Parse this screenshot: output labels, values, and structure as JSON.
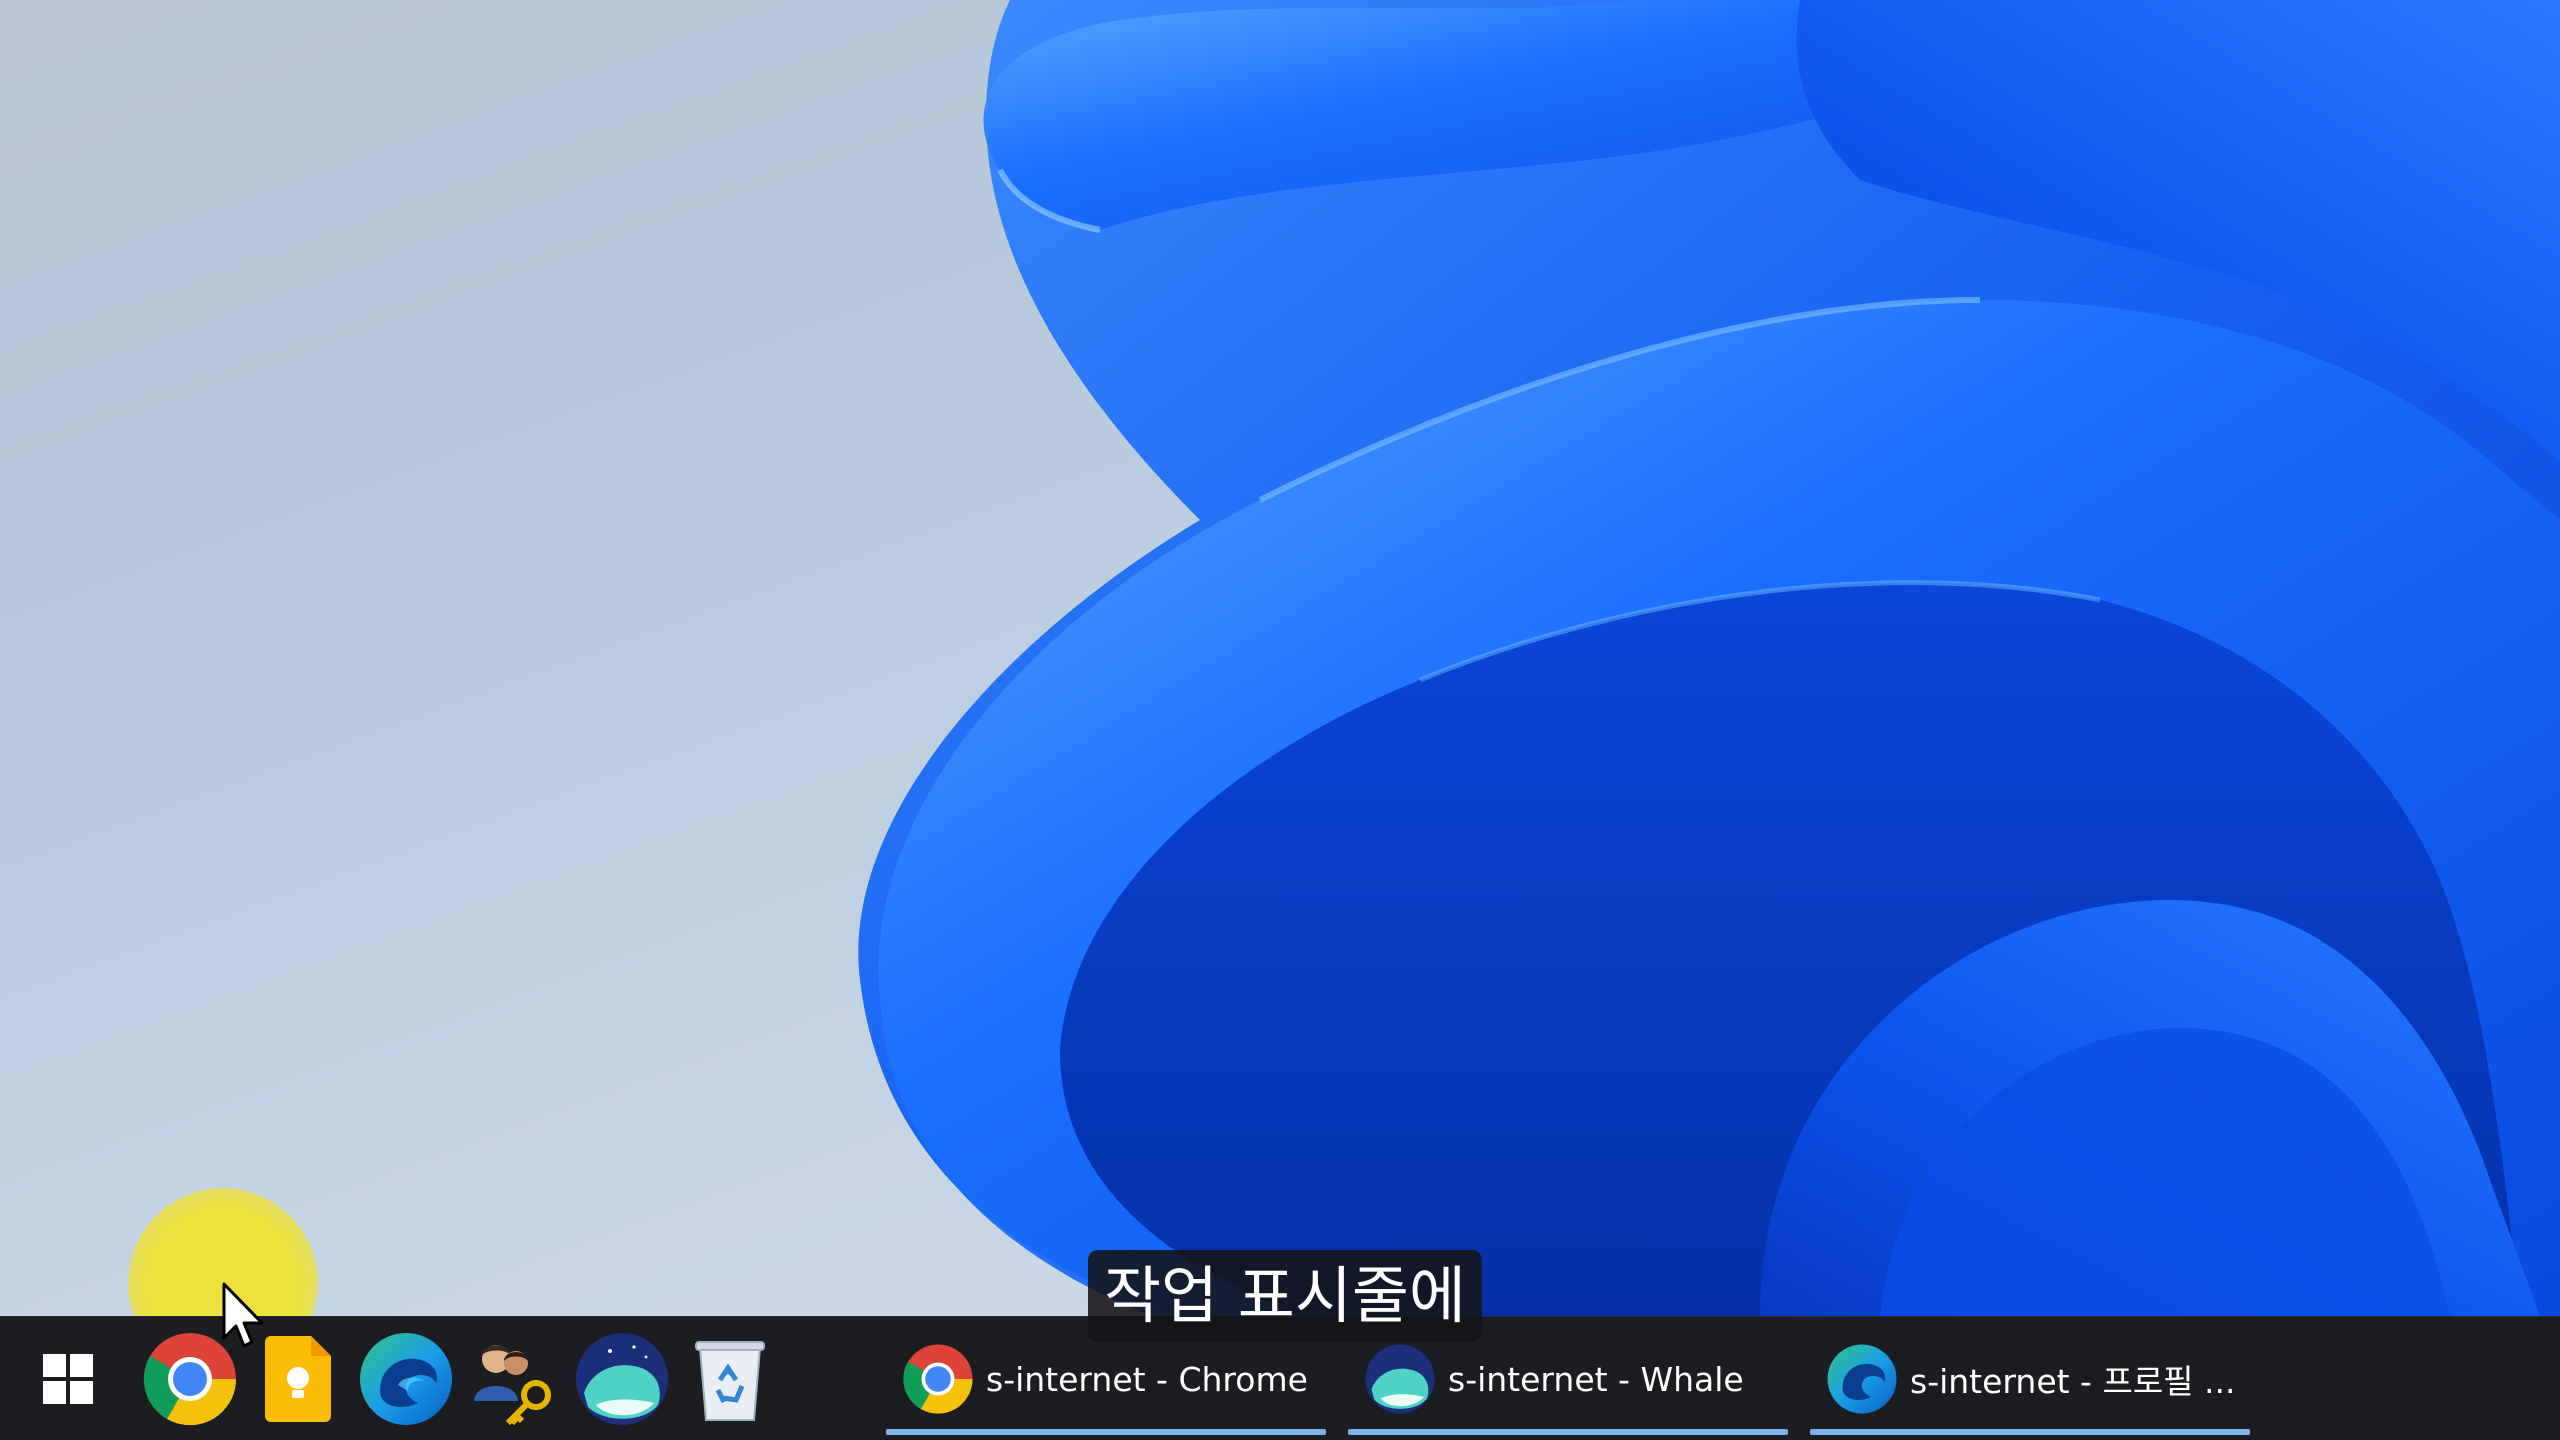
{
  "taskbar": {
    "pinned_icons": [
      {
        "name": "start-icon"
      },
      {
        "name": "chrome-icon"
      },
      {
        "name": "google-keep-icon"
      },
      {
        "name": "edge-icon"
      },
      {
        "name": "user-accounts-key-icon"
      },
      {
        "name": "whale-icon"
      },
      {
        "name": "recycle-bin-icon"
      }
    ],
    "windows": [
      {
        "label": "s-internet - Chrome",
        "icon": "chrome-icon"
      },
      {
        "label": "s-internet - Whale",
        "icon": "whale-icon"
      },
      {
        "label": "s-internet - 프로필 ...",
        "icon": "edge-icon"
      }
    ],
    "background_color": "#1b1d21",
    "active_underline_color": "#7ab4ea"
  },
  "subtitle": {
    "text": "작업 표시줄에"
  },
  "cursor_highlight_color": "#eee234",
  "wallpaper_accent_color": "#0a5cf0"
}
